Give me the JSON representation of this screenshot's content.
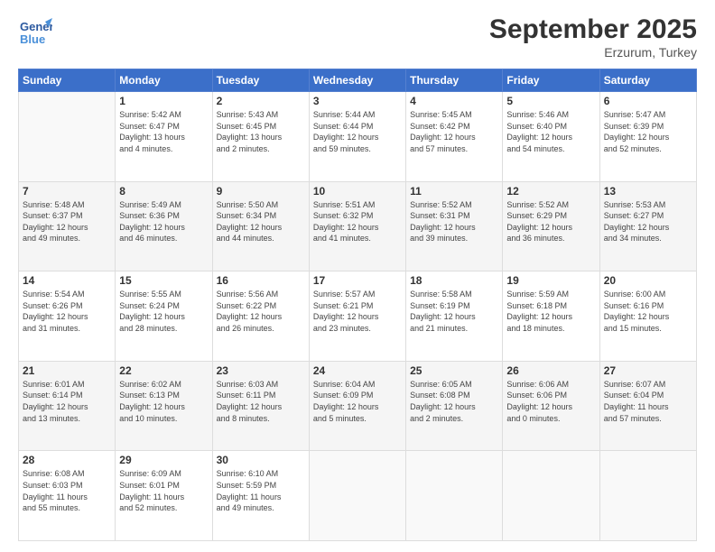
{
  "header": {
    "logo_line1": "General",
    "logo_line2": "Blue",
    "month": "September 2025",
    "location": "Erzurum, Turkey"
  },
  "weekdays": [
    "Sunday",
    "Monday",
    "Tuesday",
    "Wednesday",
    "Thursday",
    "Friday",
    "Saturday"
  ],
  "weeks": [
    [
      {
        "day": "",
        "info": ""
      },
      {
        "day": "1",
        "info": "Sunrise: 5:42 AM\nSunset: 6:47 PM\nDaylight: 13 hours\nand 4 minutes."
      },
      {
        "day": "2",
        "info": "Sunrise: 5:43 AM\nSunset: 6:45 PM\nDaylight: 13 hours\nand 2 minutes."
      },
      {
        "day": "3",
        "info": "Sunrise: 5:44 AM\nSunset: 6:44 PM\nDaylight: 12 hours\nand 59 minutes."
      },
      {
        "day": "4",
        "info": "Sunrise: 5:45 AM\nSunset: 6:42 PM\nDaylight: 12 hours\nand 57 minutes."
      },
      {
        "day": "5",
        "info": "Sunrise: 5:46 AM\nSunset: 6:40 PM\nDaylight: 12 hours\nand 54 minutes."
      },
      {
        "day": "6",
        "info": "Sunrise: 5:47 AM\nSunset: 6:39 PM\nDaylight: 12 hours\nand 52 minutes."
      }
    ],
    [
      {
        "day": "7",
        "info": "Sunrise: 5:48 AM\nSunset: 6:37 PM\nDaylight: 12 hours\nand 49 minutes."
      },
      {
        "day": "8",
        "info": "Sunrise: 5:49 AM\nSunset: 6:36 PM\nDaylight: 12 hours\nand 46 minutes."
      },
      {
        "day": "9",
        "info": "Sunrise: 5:50 AM\nSunset: 6:34 PM\nDaylight: 12 hours\nand 44 minutes."
      },
      {
        "day": "10",
        "info": "Sunrise: 5:51 AM\nSunset: 6:32 PM\nDaylight: 12 hours\nand 41 minutes."
      },
      {
        "day": "11",
        "info": "Sunrise: 5:52 AM\nSunset: 6:31 PM\nDaylight: 12 hours\nand 39 minutes."
      },
      {
        "day": "12",
        "info": "Sunrise: 5:52 AM\nSunset: 6:29 PM\nDaylight: 12 hours\nand 36 minutes."
      },
      {
        "day": "13",
        "info": "Sunrise: 5:53 AM\nSunset: 6:27 PM\nDaylight: 12 hours\nand 34 minutes."
      }
    ],
    [
      {
        "day": "14",
        "info": "Sunrise: 5:54 AM\nSunset: 6:26 PM\nDaylight: 12 hours\nand 31 minutes."
      },
      {
        "day": "15",
        "info": "Sunrise: 5:55 AM\nSunset: 6:24 PM\nDaylight: 12 hours\nand 28 minutes."
      },
      {
        "day": "16",
        "info": "Sunrise: 5:56 AM\nSunset: 6:22 PM\nDaylight: 12 hours\nand 26 minutes."
      },
      {
        "day": "17",
        "info": "Sunrise: 5:57 AM\nSunset: 6:21 PM\nDaylight: 12 hours\nand 23 minutes."
      },
      {
        "day": "18",
        "info": "Sunrise: 5:58 AM\nSunset: 6:19 PM\nDaylight: 12 hours\nand 21 minutes."
      },
      {
        "day": "19",
        "info": "Sunrise: 5:59 AM\nSunset: 6:18 PM\nDaylight: 12 hours\nand 18 minutes."
      },
      {
        "day": "20",
        "info": "Sunrise: 6:00 AM\nSunset: 6:16 PM\nDaylight: 12 hours\nand 15 minutes."
      }
    ],
    [
      {
        "day": "21",
        "info": "Sunrise: 6:01 AM\nSunset: 6:14 PM\nDaylight: 12 hours\nand 13 minutes."
      },
      {
        "day": "22",
        "info": "Sunrise: 6:02 AM\nSunset: 6:13 PM\nDaylight: 12 hours\nand 10 minutes."
      },
      {
        "day": "23",
        "info": "Sunrise: 6:03 AM\nSunset: 6:11 PM\nDaylight: 12 hours\nand 8 minutes."
      },
      {
        "day": "24",
        "info": "Sunrise: 6:04 AM\nSunset: 6:09 PM\nDaylight: 12 hours\nand 5 minutes."
      },
      {
        "day": "25",
        "info": "Sunrise: 6:05 AM\nSunset: 6:08 PM\nDaylight: 12 hours\nand 2 minutes."
      },
      {
        "day": "26",
        "info": "Sunrise: 6:06 AM\nSunset: 6:06 PM\nDaylight: 12 hours\nand 0 minutes."
      },
      {
        "day": "27",
        "info": "Sunrise: 6:07 AM\nSunset: 6:04 PM\nDaylight: 11 hours\nand 57 minutes."
      }
    ],
    [
      {
        "day": "28",
        "info": "Sunrise: 6:08 AM\nSunset: 6:03 PM\nDaylight: 11 hours\nand 55 minutes."
      },
      {
        "day": "29",
        "info": "Sunrise: 6:09 AM\nSunset: 6:01 PM\nDaylight: 11 hours\nand 52 minutes."
      },
      {
        "day": "30",
        "info": "Sunrise: 6:10 AM\nSunset: 5:59 PM\nDaylight: 11 hours\nand 49 minutes."
      },
      {
        "day": "",
        "info": ""
      },
      {
        "day": "",
        "info": ""
      },
      {
        "day": "",
        "info": ""
      },
      {
        "day": "",
        "info": ""
      }
    ]
  ]
}
